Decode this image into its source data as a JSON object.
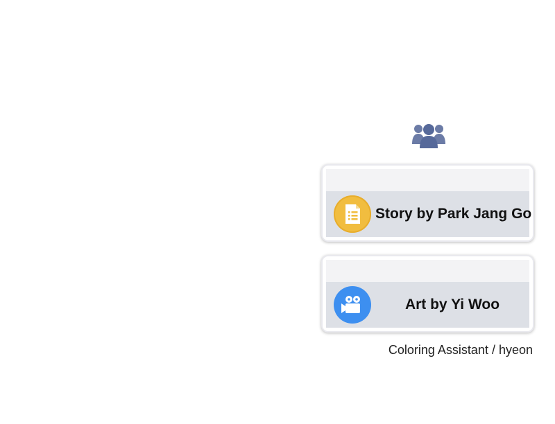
{
  "credits": {
    "icon": "people-group-icon",
    "story": {
      "label": "Story by Park Jang Go",
      "icon": "document-icon",
      "badge_color": "#f1bd3f"
    },
    "art": {
      "label": "Art by Yi Woo",
      "icon": "video-camera-icon",
      "badge_color": "#3d8ff0"
    },
    "assistant": "Coloring Assistant / hyeon"
  },
  "colors": {
    "people_icon": "#5b6e9c",
    "card_body": "#dde0e6"
  }
}
